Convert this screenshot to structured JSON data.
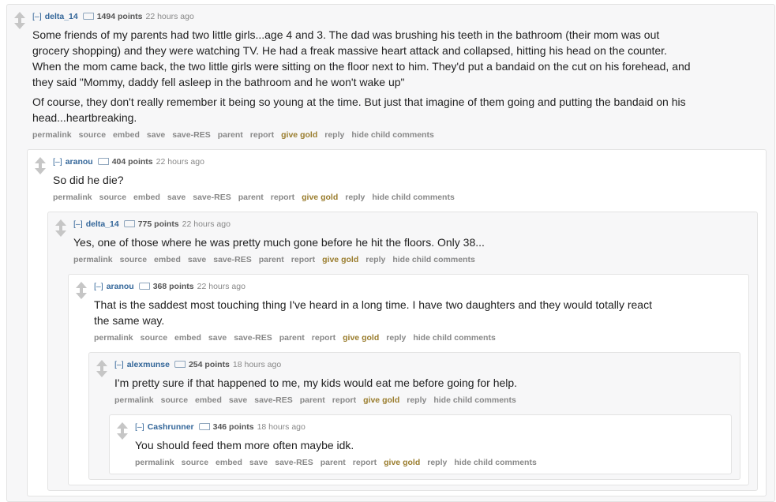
{
  "ui": {
    "toggle": "[–]",
    "points_suffix": "points",
    "actions": {
      "permalink": "permalink",
      "source": "source",
      "embed": "embed",
      "save": "save",
      "save_res": "save-RES",
      "parent": "parent",
      "report": "report",
      "give_gold": "give gold",
      "reply": "reply",
      "hide_child": "hide child comments"
    }
  },
  "comments": [
    {
      "author": "delta_14",
      "points": "1494 points",
      "time": "22 hours ago",
      "paragraphs": [
        "Some friends of my parents had two little girls...age 4 and 3. The dad was brushing his teeth in the bathroom (their mom was out grocery shopping) and they were watching TV. He had a freak massive heart attack and collapsed, hitting his head on the counter. When the mom came back, the two little girls were sitting on the floor next to him. They'd put a bandaid on the cut on his forehead, and they said \"Mommy, daddy fell asleep in the bathroom and he won't wake up\"",
        "Of course, they don't really remember it being so young at the time. But just that imagine of them going and putting the bandaid on his head...heartbreaking."
      ]
    },
    {
      "author": "aranou",
      "points": "404 points",
      "time": "22 hours ago",
      "paragraphs": [
        "So did he die?"
      ]
    },
    {
      "author": "delta_14",
      "points": "775 points",
      "time": "22 hours ago",
      "paragraphs": [
        "Yes, one of those where he was pretty much gone before he hit the floors. Only 38..."
      ]
    },
    {
      "author": "aranou",
      "points": "368 points",
      "time": "22 hours ago",
      "paragraphs": [
        "That is the saddest most touching thing I've heard in a long time. I have two daughters and they would totally react the same way."
      ]
    },
    {
      "author": "alexmunse",
      "points": "254 points",
      "time": "18 hours ago",
      "paragraphs": [
        "I'm pretty sure if that happened to me, my kids would eat me before going for help."
      ]
    },
    {
      "author": "Cashrunner",
      "points": "346 points",
      "time": "18 hours ago",
      "paragraphs": [
        "You should feed them more often maybe idk."
      ]
    }
  ]
}
